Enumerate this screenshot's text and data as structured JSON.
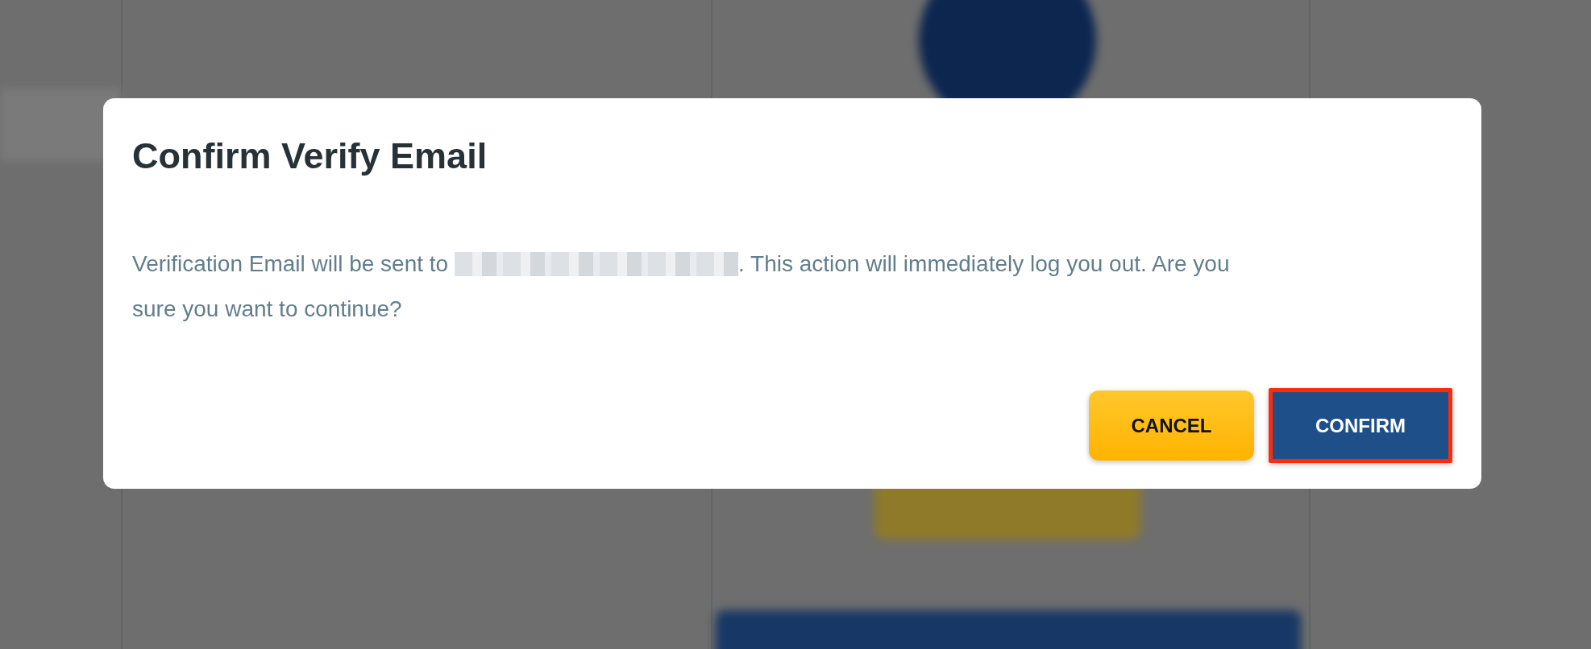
{
  "dialog": {
    "title": "Confirm Verify Email",
    "message_before": "Verification Email will be sent to ",
    "email_redacted": true,
    "message_after": ". This action will immediately log you out. Are you",
    "message_line_2": "sure you want to continue?",
    "buttons": [
      {
        "label": "CANCEL",
        "kind": "secondary",
        "highlighted": false
      },
      {
        "label": "CONFIRM",
        "kind": "primary",
        "highlighted": true
      }
    ]
  }
}
